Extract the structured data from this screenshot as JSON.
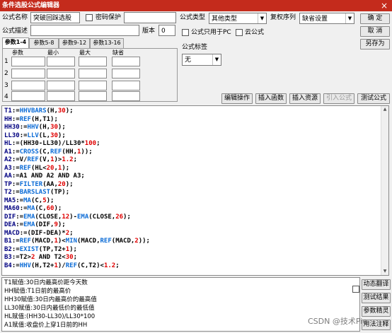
{
  "window": {
    "title": "条件选股公式编辑器",
    "close": "×"
  },
  "form": {
    "name_label": "公式名称",
    "name_value": "突破回踩选股",
    "password_label": "密码保护",
    "desc_label": "公式描述",
    "version_label": "版本",
    "version_value": "0",
    "type_label": "公式类型",
    "type_value": "其他类型",
    "reweight_label": "复权序列",
    "reweight_value": "缺省设置",
    "pc_only_label": "公式只用于PC",
    "cloud_label": "云公式",
    "tag_label": "公式标签",
    "tag_value": "无"
  },
  "buttons": {
    "ok": "确 定",
    "cancel": "取 消",
    "save_as": "另存为",
    "edit_op": "编辑操作",
    "insert_func": "插入函数",
    "insert_res": "插入资源",
    "import_formula": "引入公式",
    "test_formula": "测试公式",
    "dyn_translate": "动态翻译",
    "test_result": "测试结果",
    "param_wizard": "参数精灵",
    "usage_note": "用法注释"
  },
  "tabs": [
    "参数1-4",
    "参数5-8",
    "参数9-12",
    "参数13-16"
  ],
  "params": {
    "headers": [
      "参数",
      "最小",
      "最大",
      "缺省"
    ],
    "rows": [
      "1",
      "2",
      "3",
      "4"
    ]
  },
  "code_lines": [
    "T1:=HHVBARS(H,30);",
    "HH:=REF(H,T1);",
    "HH30:=HHV(H,30);",
    "LL30:=LLV(L,30);",
    "HL:=(HH30-LL30)/LL30*100;",
    "A1:=CROSS(C,REF(HH,1));",
    "A2:=V/REF(V,1)>1.2;",
    "A3:=REF(HL<20,1);",
    "AA:=A1 AND A2 AND A3;",
    "TP:=FILTER(AA,20);",
    "T2:=BARSLAST(TP);",
    "MA5:=MA(C,5);",
    "MA60:=MA(C,60);",
    "DIF:=EMA(CLOSE,12)-EMA(CLOSE,26);",
    "DEA:=EMA(DIF,9);",
    "MACD:=(DIF-DEA)*2;",
    "B1:=REF(MACD,1)<MIN(MACD,REF(MACD,2));",
    "B2:=EXIST(TP,T2+1);",
    "B3:=T2>2 AND T2<30;",
    "B4:=HHV(H,T2+1)/REF(C,T2)<1.2;"
  ],
  "notes": [
    "T1赋值:30日内最高价距今天数",
    "HH赋值:T1日前的最高价",
    "HH30赋值:30日内最高价的最高值",
    "LL30赋值:30日内最低价的最低值",
    "HL赋值:(HH30-LL30)/LL30*100",
    "A1赋值:收盘价上穿1日前的HH"
  ],
  "watermark": "CSDN @技术Pie",
  "colors": {
    "titlebar": "#c42b1c",
    "variable": "#000080",
    "function": "#0b6bd6",
    "number": "#e00000"
  }
}
